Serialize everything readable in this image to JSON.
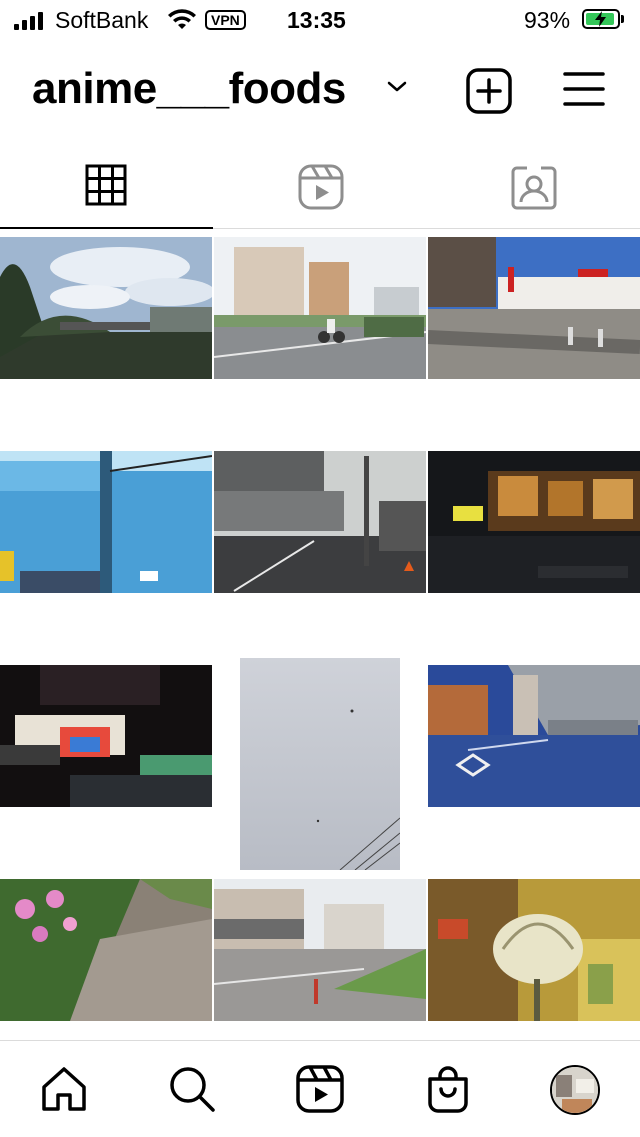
{
  "status_bar": {
    "carrier": "SoftBank",
    "vpn": "VPN",
    "time": "13:35",
    "battery": "93%",
    "battery_level": 0.93
  },
  "header": {
    "username": "anime___foods"
  },
  "tabs": [
    {
      "name": "posts-grid",
      "icon": "grid-icon",
      "active": true
    },
    {
      "name": "reels",
      "icon": "reels-icon",
      "active": false
    },
    {
      "name": "tagged",
      "icon": "tagged-person-icon",
      "active": false
    }
  ],
  "bottom_nav": [
    {
      "name": "home",
      "icon": "home-icon"
    },
    {
      "name": "search",
      "icon": "search-icon"
    },
    {
      "name": "reels",
      "icon": "reels-icon"
    },
    {
      "name": "shop",
      "icon": "shopping-bag-icon"
    },
    {
      "name": "profile",
      "icon": "avatar"
    }
  ],
  "colors": {
    "accent": "#000000",
    "battery": "#34c759",
    "divider": "#dbdbdb"
  }
}
